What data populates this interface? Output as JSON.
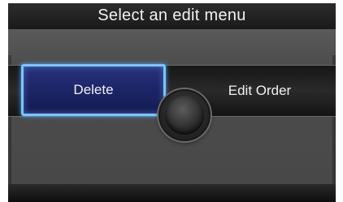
{
  "title": "Select an edit menu",
  "buttons": {
    "delete_label": "Delete",
    "edit_order_label": "Edit Order"
  },
  "colors": {
    "highlight_border": "#7ec3ff",
    "highlight_fill": "#1c2566",
    "background": "#4a4a4a"
  }
}
